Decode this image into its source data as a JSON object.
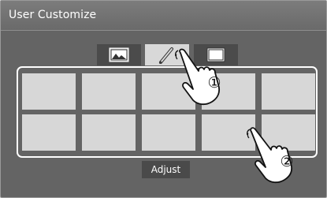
{
  "window": {
    "title": "User Customize"
  },
  "tabs": [
    {
      "icon": "image-icon",
      "active": false
    },
    {
      "icon": "pencil-icon",
      "active": true
    },
    {
      "icon": "frame-icon",
      "active": false
    }
  ],
  "tiles": {
    "rows": 2,
    "columns": 5
  },
  "adjust_button": {
    "label": "Adjust"
  },
  "callouts": [
    {
      "label": "①"
    },
    {
      "label": "②"
    }
  ],
  "colors": {
    "screen_bg": "#646464",
    "tile": "#d7d7d7",
    "active_tab": "#d8d8d8",
    "button_bg": "#4a4a4a"
  }
}
